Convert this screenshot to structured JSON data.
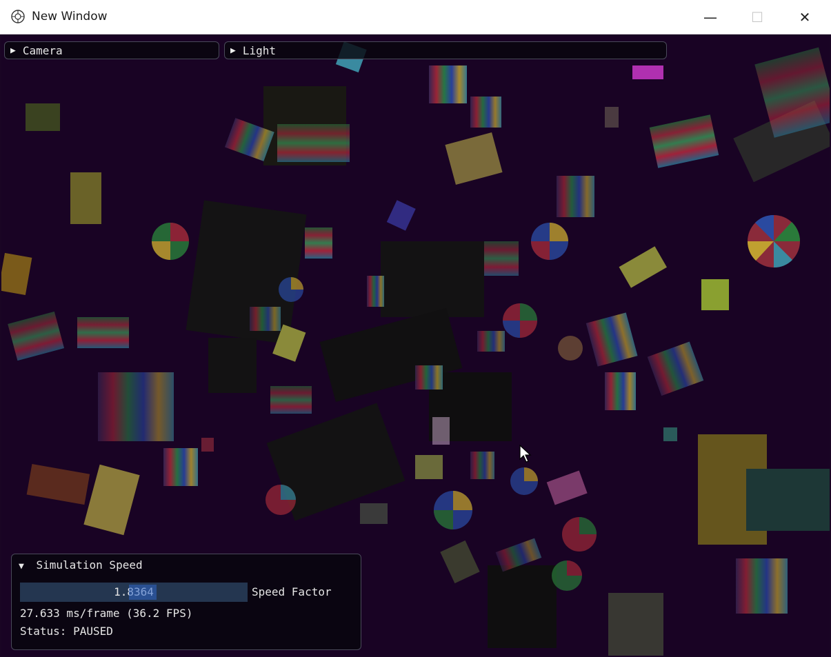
{
  "window": {
    "title": "New Window",
    "controls": {
      "minimize": "—",
      "maximize": "☐",
      "close": "✕"
    }
  },
  "headers": {
    "camera": {
      "label": "Camera",
      "icon": "triangle-right-icon"
    },
    "light": {
      "label": "Light",
      "icon": "triangle-right-icon"
    }
  },
  "simulation": {
    "title": "Simulation Speed",
    "icon": "triangle-down-icon",
    "speed_value": "1.8364",
    "speed_label": "Speed Factor",
    "frame_stats": "27.633 ms/frame (36.2 FPS)",
    "status": "Status: PAUSED"
  },
  "colors": {
    "background": "#190324",
    "panel": "#08060e",
    "slider": "#243650"
  }
}
